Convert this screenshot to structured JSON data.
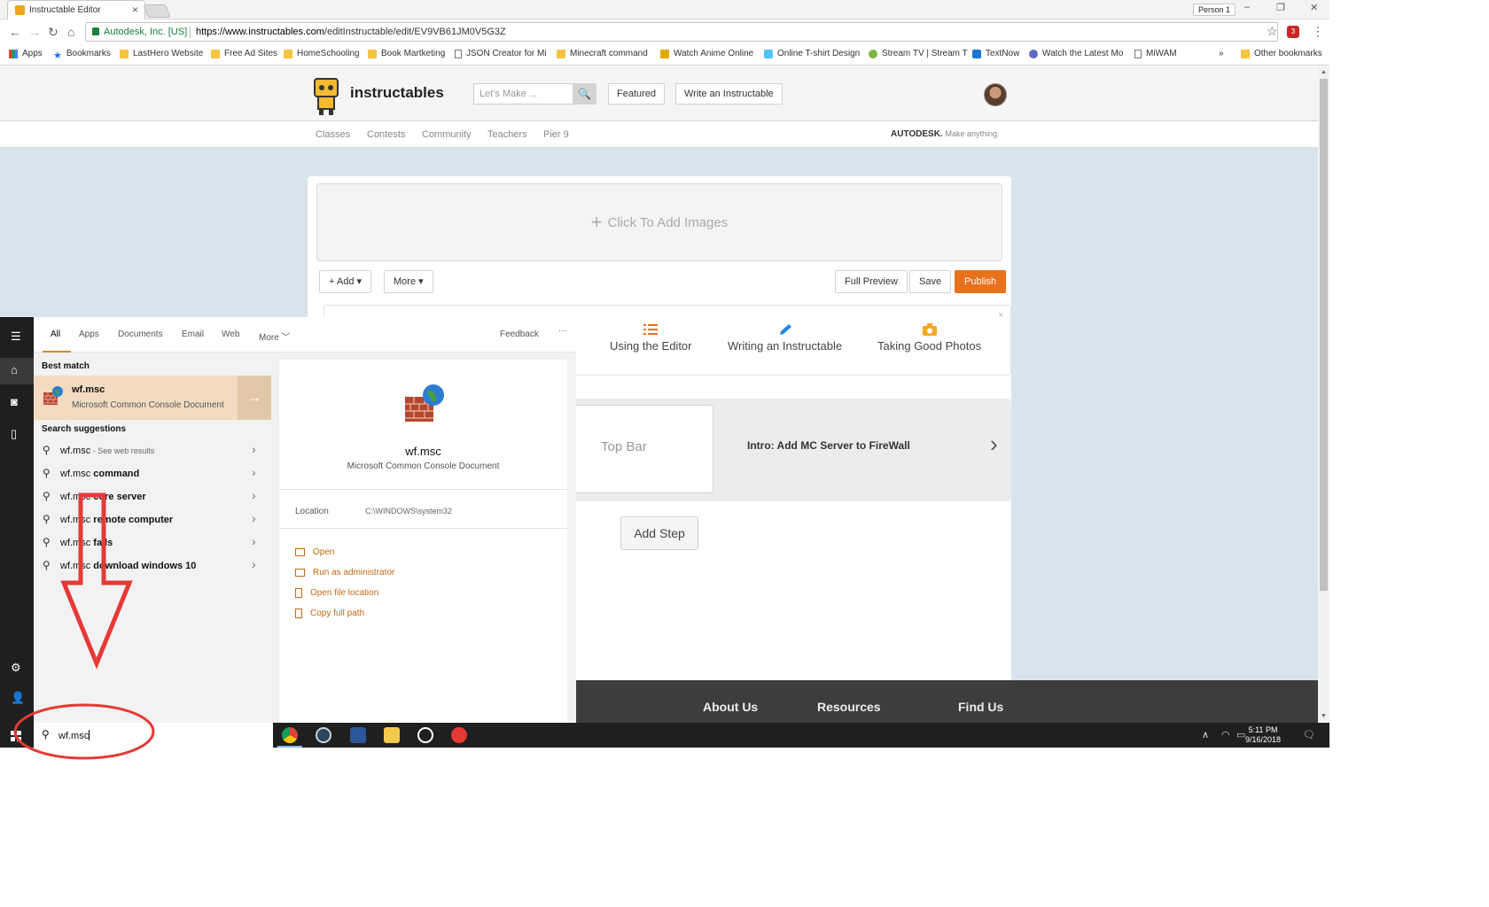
{
  "browser": {
    "tab_title": "Instructable Editor",
    "tab_close": "×",
    "profile": "Person 1",
    "window_controls": [
      "–",
      "❐",
      "✕"
    ],
    "secure_label": "Autodesk, Inc. [US]",
    "url_host": "https://www.instructables.com",
    "url_path": "/editInstructable/edit/EV9VB61JM0V5G3Z",
    "nav": [
      "←",
      "→",
      "↻",
      "⌂"
    ],
    "star": "☆",
    "menu": "⋮",
    "ext_badge": "3"
  },
  "bookmarks": {
    "items": [
      {
        "label": "Apps",
        "icon": "apps-icon"
      },
      {
        "label": "Bookmarks",
        "icon": "star-icon"
      },
      {
        "label": "LastHero Website",
        "icon": "folder-icon"
      },
      {
        "label": "Free Ad Sites",
        "icon": "folder-icon"
      },
      {
        "label": "HomeSchooling",
        "icon": "folder-icon"
      },
      {
        "label": "Book Martketing",
        "icon": "folder-icon"
      },
      {
        "label": "JSON Creator for Mi",
        "icon": "page-icon"
      },
      {
        "label": "Minecraft command",
        "icon": "folder-icon"
      },
      {
        "label": "Watch Anime Online",
        "icon": "crown-icon"
      },
      {
        "label": "Online T-shirt Design",
        "icon": "shirt-icon"
      },
      {
        "label": "Stream TV | Stream T",
        "icon": "tv-icon"
      },
      {
        "label": "TextNow",
        "icon": "textnow-icon"
      },
      {
        "label": "Watch the Latest Mo",
        "icon": "film-icon"
      },
      {
        "label": "MiWAM",
        "icon": "page-icon"
      }
    ],
    "overflow": "»",
    "other": "Other bookmarks"
  },
  "site": {
    "logo_text": "instructables",
    "search_placeholder": "Let's Make ...",
    "search_icon": "🔍",
    "featured": "Featured",
    "write": "Write an Instructable",
    "subnav": [
      "Classes",
      "Contests",
      "Community",
      "Teachers",
      "Pier 9"
    ],
    "autodesk": "AUTODESK.",
    "autodesk_tag": "Make anything."
  },
  "editor": {
    "add_images": "Click To Add Images",
    "add_images_plus": "+",
    "add_btn": "+ Add ▾",
    "more_btn": "More ▾",
    "full_preview": "Full Preview",
    "save": "Save",
    "publish": "Publish",
    "tips": [
      "Using the Editor",
      "Writing an Instructable",
      "Taking Good Photos"
    ],
    "tips_close": "×",
    "step_card_text": "Top Bar",
    "intro_label": "Intro: Add MC Server to FireWall",
    "chevron": "›",
    "add_step": "Add Step"
  },
  "footer": {
    "links": [
      "About Us",
      "Resources",
      "Find Us"
    ]
  },
  "win_search": {
    "filters": [
      "All",
      "Apps",
      "Documents",
      "Email",
      "Web",
      "More"
    ],
    "more_chevron": "﹀",
    "feedback": "Feedback",
    "ellipsis": "···",
    "best_match_label": "Best match",
    "best_match_title": "wf.msc",
    "best_match_sub": "Microsoft Common Console Document",
    "best_match_arrow": "→",
    "suggestions_label": "Search suggestions",
    "suggestions": [
      {
        "query": "wf.msc",
        "suffix": " - See web results"
      },
      {
        "query": "wf.msc",
        "suffix": " command"
      },
      {
        "query": "wf.msc",
        "suffix": " core server"
      },
      {
        "query": "wf.msc",
        "suffix": " remote computer"
      },
      {
        "query": "wf.msc",
        "suffix": " fails"
      },
      {
        "query": "wf.msc",
        "suffix": " download windows 10"
      }
    ],
    "sugg_icon": "⚲",
    "sugg_chev": "›",
    "detail_title": "wf.msc",
    "detail_sub": "Microsoft Common Console Document",
    "location_label": "Location",
    "location_value": "C:\\WINDOWS\\system32",
    "actions": [
      "Open",
      "Run as administrator",
      "Open file location",
      "Copy full path"
    ],
    "query": "wf.msc",
    "rail_icons": [
      "☰",
      "⌂",
      "◙",
      "▯",
      "⚙",
      "👤"
    ]
  },
  "taskbar": {
    "tray_up": "∧",
    "clock_time": "5:11 PM",
    "clock_date": "9/16/2018",
    "notification": "🗨"
  },
  "colors": {
    "publish": "#e9711c",
    "best_match_bg": "#f1dcc1",
    "action_text": "#c46a12",
    "annotation": "#e53935"
  }
}
